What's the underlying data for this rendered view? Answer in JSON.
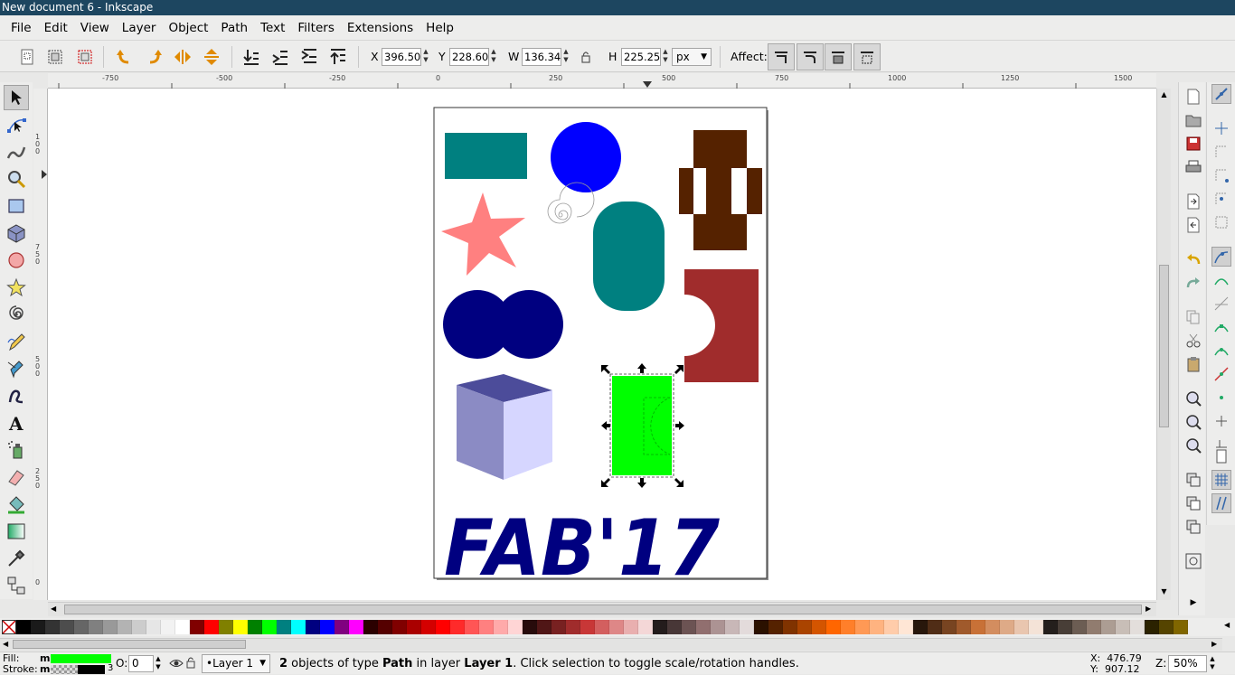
{
  "window": {
    "title": "New document 6 - Inkscape"
  },
  "menu": [
    "File",
    "Edit",
    "View",
    "Layer",
    "Object",
    "Path",
    "Text",
    "Filters",
    "Extensions",
    "Help"
  ],
  "toolbar": {
    "x_label": "X",
    "x_value": "396.500",
    "y_label": "Y",
    "y_value": "228.600",
    "w_label": "W",
    "w_value": "136.344",
    "h_label": "H",
    "h_value": "225.250",
    "unit": "px",
    "affect_label": "Affect:"
  },
  "rulers": {
    "h_ticks": [
      "-750",
      "-500",
      "-250",
      "0",
      "250",
      "500",
      "750",
      "1000",
      "1250",
      "1500"
    ],
    "v_ticks": [
      "100",
      "750",
      "500",
      "250",
      "0"
    ]
  },
  "canvas": {
    "logo_text": "FAB'17",
    "colors": {
      "teal": "#008080",
      "blue": "#0000ff",
      "brown": "#552200",
      "pink": "#ff8080",
      "navy": "#000080",
      "red": "#a02c2c",
      "green": "#00ff00",
      "cube_top": "#4c4c9a",
      "cube_left": "#8b8bc4",
      "cube_right": "#d6d6ff"
    }
  },
  "palette": [
    "#000000",
    "#1a1a1a",
    "#333333",
    "#4d4d4d",
    "#666666",
    "#808080",
    "#999999",
    "#b3b3b3",
    "#cccccc",
    "#e6e6e6",
    "#f2f2f2",
    "#ffffff",
    "#800000",
    "#ff0000",
    "#808000",
    "#ffff00",
    "#008000",
    "#00ff00",
    "#008080",
    "#00ffff",
    "#000080",
    "#0000ff",
    "#800080",
    "#ff00ff",
    "#2b0000",
    "#550000",
    "#800000",
    "#aa0000",
    "#d40000",
    "#ff0000",
    "#ff2a2a",
    "#ff5555",
    "#ff8080",
    "#ffaaaa",
    "#ffd5d5",
    "#280b0b",
    "#501616",
    "#782121",
    "#a02c2c",
    "#c83737",
    "#d35f5f",
    "#de8787",
    "#e9afaf",
    "#f4d7d7",
    "#241c1c",
    "#483737",
    "#6c5353",
    "#916f6f",
    "#ac9393",
    "#c8b7b7",
    "#e3dbdb",
    "#2b1100",
    "#552200",
    "#803300",
    "#aa4400",
    "#d45500",
    "#ff6600",
    "#ff7f2a",
    "#ff9955",
    "#ffb380",
    "#ffccaa",
    "#ffe6d5",
    "#28170b",
    "#502d16",
    "#784421",
    "#a05a2c",
    "#c87137",
    "#d38d5f",
    "#deaa87",
    "#e9c6af",
    "#f4e3d7",
    "#241f1c",
    "#483e37",
    "#6c5d53",
    "#917c6f",
    "#ac9d93",
    "#c8beb7",
    "#e3dedb",
    "#2b2200",
    "#554400",
    "#806600"
  ],
  "status": {
    "fill_label": "Fill:",
    "stroke_label": "Stroke:",
    "fill_value": "m",
    "stroke_value": "m",
    "stroke_width": "3",
    "fill_color": "#00ff00",
    "opacity_label": "O:",
    "opacity_value": "0",
    "layer": "•Layer 1",
    "message_count": "2",
    "message_a": " objects of type ",
    "message_type": "Path",
    "message_b": " in layer ",
    "message_layer": "Layer 1",
    "message_c": ". Click selection to toggle scale/rotation handles.",
    "x_coord": "X:  476.79",
    "y_coord": "Y:  907.12",
    "zoom_label": "Z:",
    "zoom_value": "50%"
  }
}
